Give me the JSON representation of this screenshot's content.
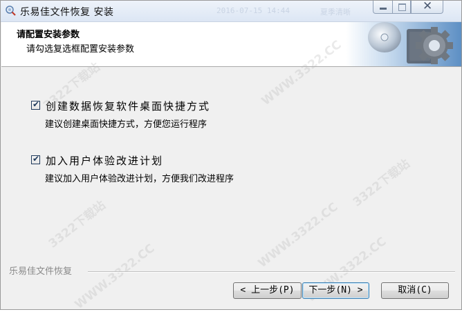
{
  "window": {
    "title": "乐易佳文件恢复 安装",
    "title_watermark_left": "2016-07-15 14:44",
    "title_watermark_right": "夏季清晰",
    "close_glyph": "✕"
  },
  "header": {
    "title": "请配置安装参数",
    "subtitle": "请勾选复选框配置安装参数"
  },
  "options": [
    {
      "label": "创建数据恢复软件桌面快捷方式",
      "description": "建议创建桌面快捷方式，方便您运行程序",
      "checked": true
    },
    {
      "label": "加入用户体验改进计划",
      "description": "建议加入用户体验改进计划，方便我们改进程序",
      "checked": true
    }
  ],
  "checkmark": "✔",
  "footer": {
    "brand": "乐易佳文件恢复",
    "back_label": "< 上一步(P)",
    "next_label": "下一步(N) >",
    "cancel_label": "取消(C)"
  },
  "watermarks": [
    "3322下载站",
    "WWW.3322.CC"
  ],
  "colors": {
    "accent": "#3c7fb1",
    "header_bg": "#ffffff",
    "dialog_bg": "#f0f0f0"
  }
}
